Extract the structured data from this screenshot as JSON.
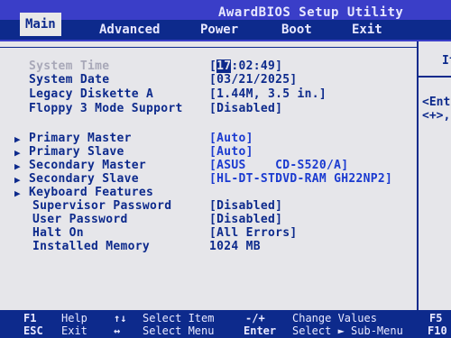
{
  "window": {
    "title": "AwardBIOS Setup Utility"
  },
  "menu": {
    "tabs": [
      {
        "label": "Main"
      },
      {
        "label": "Advanced"
      },
      {
        "label": "Power"
      },
      {
        "label": "Boot"
      },
      {
        "label": "Exit"
      }
    ],
    "active": "Main"
  },
  "settings": {
    "system_time": {
      "label": "System Time",
      "hour": "17",
      "rest": ":02:49]"
    },
    "system_date": {
      "label": "System Date",
      "value": "[03/21/2025]"
    },
    "legacy_diskette": {
      "label": "Legacy Diskette A",
      "value": "[1.44M, 3.5 in.]"
    },
    "floppy_3mode": {
      "label": "Floppy 3 Mode Support",
      "value": "[Disabled]"
    },
    "primary_master": {
      "label": "Primary Master",
      "value": "[Auto]"
    },
    "primary_slave": {
      "label": "Primary Slave",
      "value": "[Auto]"
    },
    "secondary_master": {
      "label": "Secondary Master",
      "value": "[ASUS    CD-S520/A]"
    },
    "secondary_slave": {
      "label": "Secondary Slave",
      "value": "[HL-DT-STDVD-RAM GH22NP2]"
    },
    "keyboard_features": {
      "label": "Keyboard Features"
    },
    "supervisor_password": {
      "label": "Supervisor Password",
      "value": "[Disabled]"
    },
    "user_password": {
      "label": "User Password",
      "value": "[Disabled]"
    },
    "halt_on": {
      "label": "Halt On",
      "value": "[All Errors]"
    },
    "installed_memory": {
      "label": "Installed Memory",
      "value": "1024 MB"
    }
  },
  "help": {
    "title": "It",
    "line1": "<Ent",
    "line2": "<+>,"
  },
  "footer": {
    "f1": "F1",
    "f1_desc": "Help",
    "ud": "↑↓",
    "ud_desc": "Select Item",
    "pm": "-/+",
    "pm_desc": "Change Values",
    "f5": "F5",
    "esc": "ESC",
    "esc_desc": "Exit",
    "lr": "↔",
    "lr_desc": "Select Menu",
    "enter": "Enter",
    "enter_desc": "Select ► Sub-Menu",
    "f10": "F10"
  },
  "colors": {
    "background": "#0d2a8c",
    "panel": "#e6e6ea",
    "text": "#0d2a8c",
    "dim_text": "#a8a8b8"
  }
}
